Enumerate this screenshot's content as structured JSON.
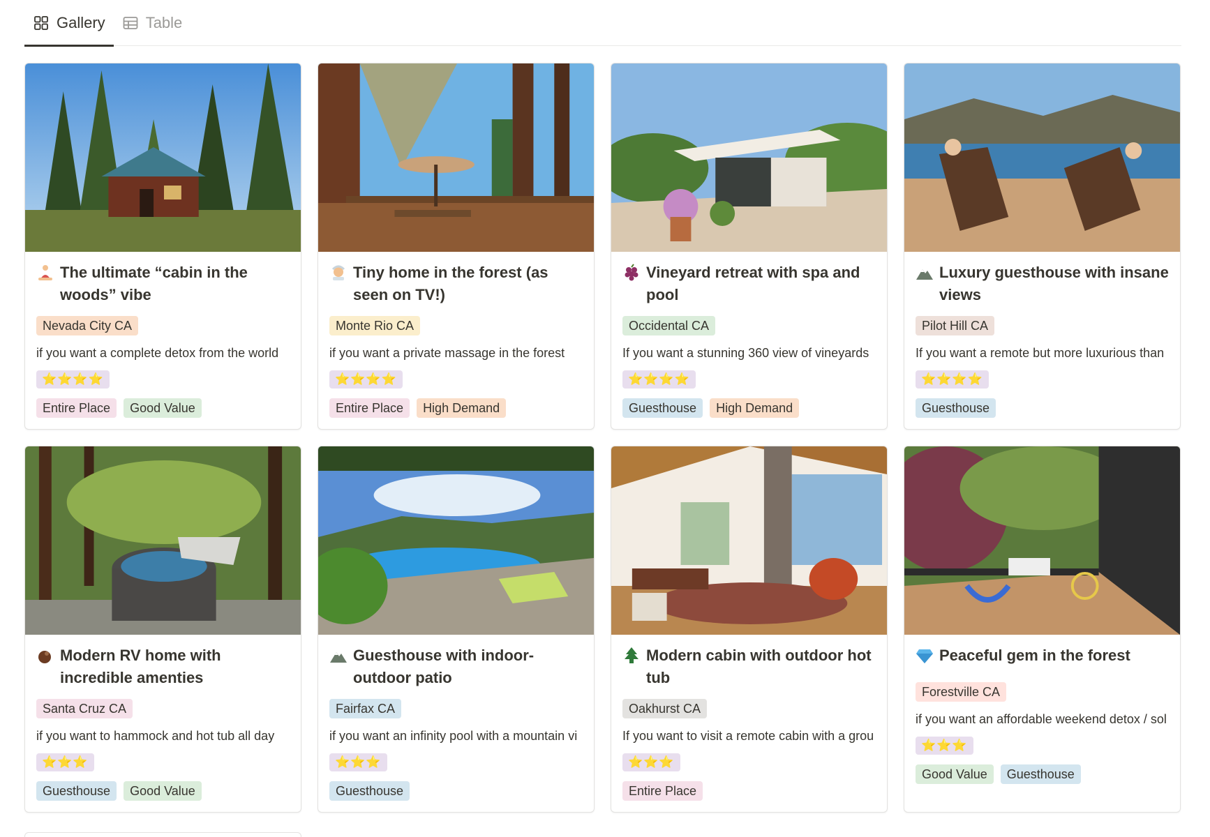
{
  "tabs": [
    {
      "label": "Gallery",
      "icon": "gallery-icon",
      "active": true
    },
    {
      "label": "Table",
      "icon": "table-icon",
      "active": false
    }
  ],
  "cards": [
    {
      "title": "The ultimate “cabin in the woods” vibe",
      "emoji": "person-meditating-icon",
      "location": "Nevada City CA",
      "location_bg": "#fadec9",
      "description": "if you want a complete detox from the world",
      "rating": "⭐⭐⭐⭐",
      "tags": [
        "Entire Place",
        "Good Value"
      ]
    },
    {
      "title": "Tiny home in the forest (as seen on TV!)",
      "emoji": "person-in-steam-icon",
      "location": "Monte Rio CA",
      "location_bg": "#fbeecc",
      "description": "if you want a private massage in the forest",
      "rating": "⭐⭐⭐⭐",
      "tags": [
        "Entire Place",
        "High Demand"
      ]
    },
    {
      "title": "Vineyard retreat with spa and pool",
      "emoji": "grapes-icon",
      "location": "Occidental CA",
      "location_bg": "#dbeddb",
      "description": "If you want a stunning 360 view of vineyards",
      "rating": "⭐⭐⭐⭐",
      "tags": [
        "Guesthouse",
        "High Demand"
      ]
    },
    {
      "title": "Luxury guesthouse with insane views",
      "emoji": "mountain-icon",
      "location": "Pilot Hill CA",
      "location_bg": "#eee0da",
      "description": "If you want a remote but more luxurious than",
      "rating": "⭐⭐⭐⭐",
      "tags": [
        "Guesthouse"
      ]
    },
    {
      "title": "Modern RV home with incredible amenties",
      "emoji": "coconut-icon",
      "location": "Santa Cruz CA",
      "location_bg": "#f5e0e9",
      "description": "if you want to hammock and hot tub all day",
      "rating": "⭐⭐⭐",
      "tags": [
        "Guesthouse",
        "Good Value"
      ]
    },
    {
      "title": "Guesthouse with indoor-outdoor patio",
      "emoji": "mountain-icon",
      "location": "Fairfax CA",
      "location_bg": "#d3e5ef",
      "description": "if you want an infinity pool with a mountain vi",
      "rating": "⭐⭐⭐",
      "tags": [
        "Guesthouse"
      ]
    },
    {
      "title": "Modern cabin with outdoor hot tub",
      "emoji": "evergreen-tree-icon",
      "location": "Oakhurst CA",
      "location_bg": "#e3e2e0",
      "description": "If you want to visit a remote cabin with a grou",
      "rating": "⭐⭐⭐",
      "tags": [
        "Entire Place"
      ]
    },
    {
      "title": "Peaceful gem in the forest",
      "emoji": "gem-icon",
      "location": "Forestville CA",
      "location_bg": "#ffe2dd",
      "description": "if you want an affordable weekend detox / sol",
      "rating": "⭐⭐⭐",
      "tags": [
        "Good Value",
        "Guesthouse"
      ]
    }
  ],
  "colors": {
    "tag_entire_place": "#f5e0e9",
    "tag_good_value": "#dbeddb",
    "tag_high_demand": "#fadec9",
    "tag_guesthouse": "#d3e5ef",
    "rating_bg": "#e8deee"
  }
}
